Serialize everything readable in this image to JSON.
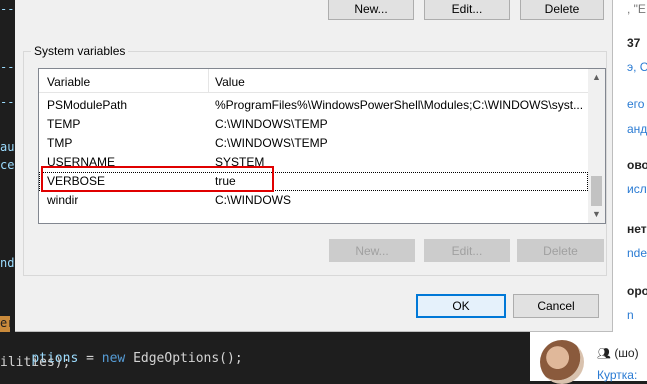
{
  "editor": {
    "fragments": [
      "--",
      "--",
      "--",
      "au",
      "ce",
      "nde",
      "er"
    ],
    "code_line_1": {
      "var": "ptions",
      "eq": " = ",
      "kw": "new",
      "rest": " EdgeOptions();"
    },
    "code_line_2": "ilities);"
  },
  "dialog": {
    "top_buttons": {
      "new": "New...",
      "edit": "Edit...",
      "delete": "Delete"
    },
    "system_variables": {
      "label": "System variables",
      "columns": [
        "Variable",
        "Value"
      ],
      "rows": [
        {
          "variable": "PSModulePath",
          "value": "%ProgramFiles%\\WindowsPowerShell\\Modules;C:\\WINDOWS\\syst..."
        },
        {
          "variable": "TEMP",
          "value": "C:\\WINDOWS\\TEMP"
        },
        {
          "variable": "TMP",
          "value": "C:\\WINDOWS\\TEMP"
        },
        {
          "variable": "USERNAME",
          "value": "SYSTEM"
        },
        {
          "variable": "VERBOSE",
          "value": "true"
        },
        {
          "variable": "windir",
          "value": "C:\\WINDOWS"
        }
      ],
      "selected_row": "VERBOSE",
      "buttons": {
        "new": "New...",
        "edit": "Edit...",
        "delete": "Delete"
      }
    },
    "ok": "OK",
    "cancel": "Cancel"
  },
  "webpanel": {
    "items": [
      ", \"E",
      "37",
      "э, С",
      "его",
      "анд",
      "ово",
      "исл",
      "нета",
      "nde",
      "оро",
      "n"
    ]
  },
  "chat": {
    "text": "(шо)",
    "link": "Куртка:"
  },
  "colors": {
    "highlight_box": "#e00000",
    "primary_button_border": "#0078d7",
    "link": "#2a7bd3"
  }
}
